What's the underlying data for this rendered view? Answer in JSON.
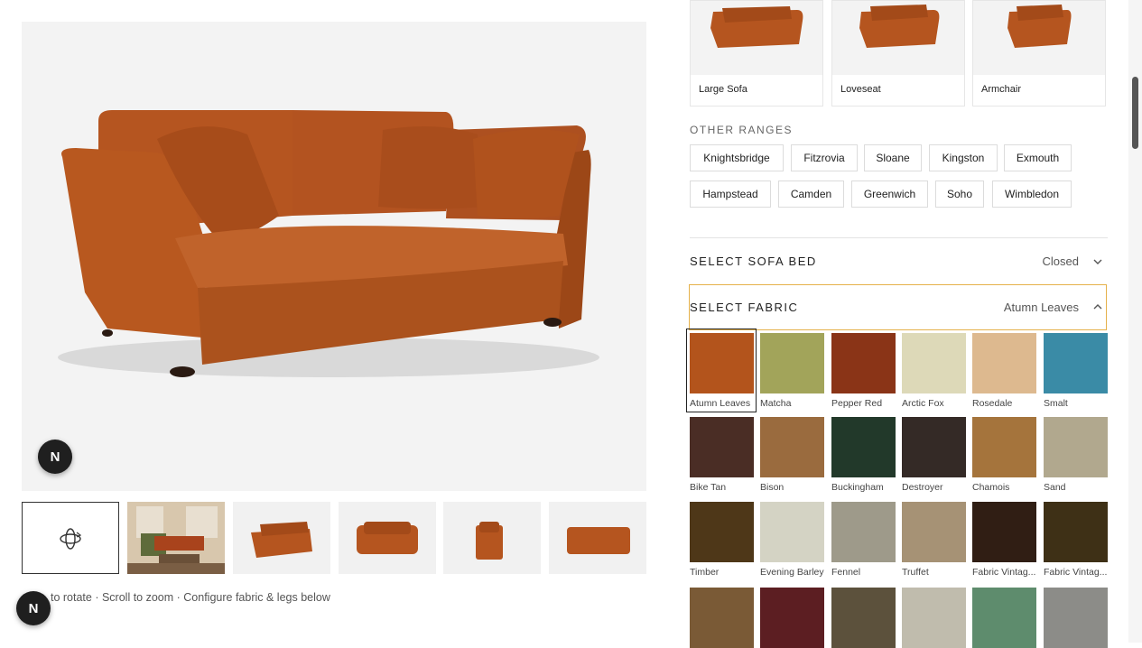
{
  "viewer": {
    "badge_label": "N",
    "hint": "to rotate · Scroll to zoom · Configure fabric & legs below"
  },
  "thumbnails": [
    {
      "name": "rotate-3d-thumb",
      "icon": "rotate-3d-icon",
      "selected": true
    },
    {
      "name": "room-photo-thumb",
      "selected": false
    },
    {
      "name": "angle-left-thumb",
      "selected": false
    },
    {
      "name": "front-view-thumb",
      "selected": false
    },
    {
      "name": "side-view-thumb",
      "selected": false
    },
    {
      "name": "back-view-thumb",
      "selected": false
    }
  ],
  "sofa_types": [
    {
      "label": "Large Sofa"
    },
    {
      "label": "Loveseat"
    },
    {
      "label": "Armchair"
    }
  ],
  "other_ranges": {
    "heading": "OTHER RANGES",
    "items": [
      "Knightsbridge",
      "Fitzrovia",
      "Sloane",
      "Kingston",
      "Exmouth",
      "Hampstead",
      "Camden",
      "Greenwich",
      "Soho",
      "Wimbledon"
    ]
  },
  "sofa_bed": {
    "title": "SELECT SOFA BED",
    "value": "Closed",
    "icon": "chevron-down-icon"
  },
  "fabric": {
    "title": "SELECT FABRIC",
    "value": "Atumn Leaves",
    "icon": "chevron-up-icon",
    "swatches": [
      {
        "label": "Atumn Leaves",
        "color": "#b3541c"
      },
      {
        "label": "Matcha",
        "color": "#a2a45a"
      },
      {
        "label": "Pepper Red",
        "color": "#8a3417"
      },
      {
        "label": "Arctic Fox",
        "color": "#ddd9b8"
      },
      {
        "label": "Rosedale",
        "color": "#ddb98f"
      },
      {
        "label": "Smalt",
        "color": "#3a8ba6"
      },
      {
        "label": "Bike Tan",
        "color": "#4a2d25"
      },
      {
        "label": "Bison",
        "color": "#9a6b3e"
      },
      {
        "label": "Buckingham",
        "color": "#22392a"
      },
      {
        "label": "Destroyer",
        "color": "#342a26"
      },
      {
        "label": "Chamois",
        "color": "#a5743c"
      },
      {
        "label": "Sand",
        "color": "#b1a88e"
      },
      {
        "label": "Timber",
        "color": "#4e3718"
      },
      {
        "label": "Evening Barley",
        "color": "#d4d3c4"
      },
      {
        "label": "Fennel",
        "color": "#9e9a8a"
      },
      {
        "label": "Truffet",
        "color": "#a69275"
      },
      {
        "label": "Fabric Vintag...",
        "color": "#301e14"
      },
      {
        "label": "Fabric Vintag...",
        "color": "#3e3016"
      },
      {
        "label": "",
        "color": "#7a5a36"
      },
      {
        "label": "",
        "color": "#5c1e22"
      },
      {
        "label": "",
        "color": "#5c513c"
      },
      {
        "label": "",
        "color": "#c0bcad"
      },
      {
        "label": "",
        "color": "#5e8c6d"
      },
      {
        "label": "",
        "color": "#8c8c88"
      }
    ],
    "selected_index": 0
  },
  "colors": {
    "accent_border": "#e5b14a",
    "sofa": "#b9581f"
  }
}
